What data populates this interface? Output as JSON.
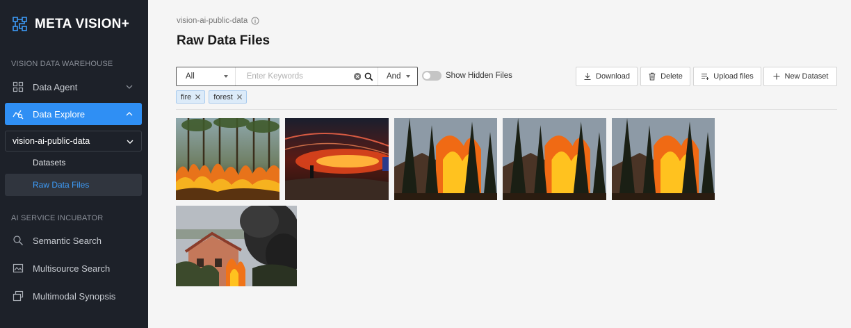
{
  "app": {
    "name": "META VISION+"
  },
  "sidebar": {
    "section1": "VISION DATA WAREHOUSE",
    "data_agent": "Data Agent",
    "data_explore": "Data Explore",
    "project": "vision-ai-public-data",
    "datasets": "Datasets",
    "raw_data_files": "Raw Data Files",
    "section2": "AI SERVICE INCUBATOR",
    "semantic_search": "Semantic Search",
    "multisource_search": "Multisource Search",
    "multimodal_synopsis": "Multimodal Synopsis"
  },
  "main": {
    "breadcrumb": "vision-ai-public-data",
    "title": "Raw Data Files"
  },
  "filter": {
    "scope": "All",
    "keyword_placeholder": "Enter Keywords",
    "logic": "And",
    "show_hidden": "Show Hidden Files",
    "show_hidden_on": false,
    "tags": [
      "fire",
      "forest"
    ]
  },
  "toolbar": {
    "download": "Download",
    "delete": "Delete",
    "upload": "Upload files",
    "new_dataset": "New Dataset"
  },
  "colors": {
    "sidebar_bg": "#1d2129",
    "accent": "#2f8ff4",
    "active_sub_text": "#3d9bf7"
  },
  "images": [
    {
      "subject": "forest-fire-pines"
    },
    {
      "subject": "firefighter-hose-night"
    },
    {
      "subject": "house-fire-trees"
    },
    {
      "subject": "house-fire-trees"
    },
    {
      "subject": "house-fire-trees"
    },
    {
      "subject": "house-fire-smoke"
    }
  ]
}
